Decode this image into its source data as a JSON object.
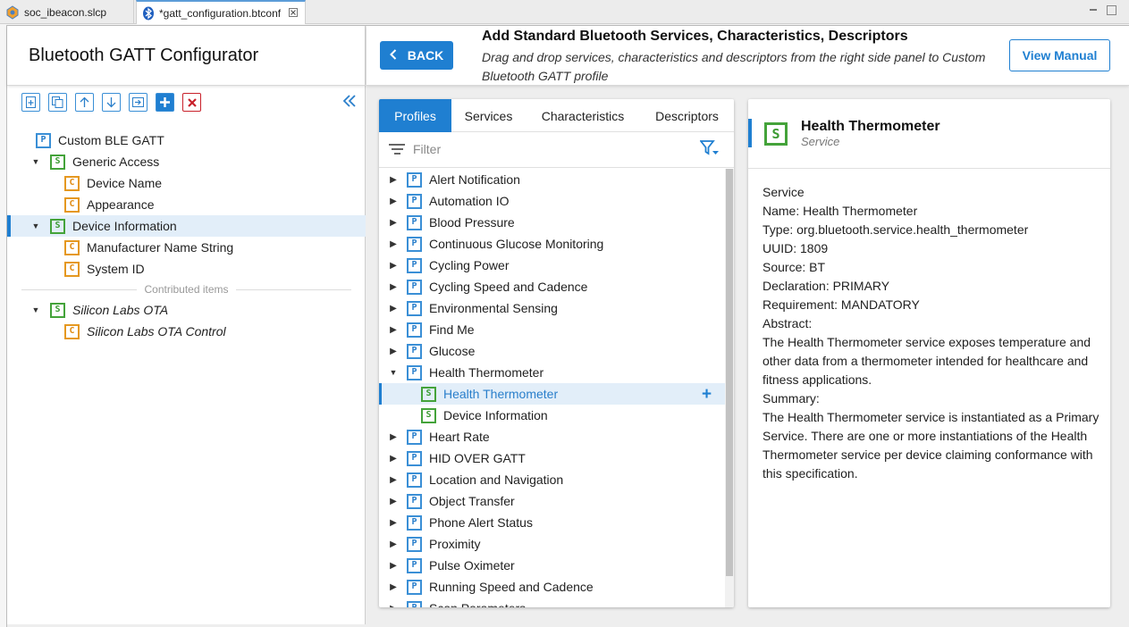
{
  "editor_tabs": [
    {
      "label": "soc_ibeacon.slcp",
      "icon": "project-icon"
    },
    {
      "label": "*gatt_configuration.btconf",
      "icon": "bluetooth-icon"
    }
  ],
  "left": {
    "title": "Bluetooth GATT Configurator",
    "toolbar": {
      "buttons": [
        "add-item-icon",
        "duplicate-icon",
        "move-up-icon",
        "move-down-icon",
        "import-icon",
        "add-icon",
        "delete-icon"
      ]
    },
    "collapse_icon": "double-chevron-left-icon",
    "tree": [
      {
        "label": "Custom BLE GATT",
        "type": "P"
      },
      {
        "label": "Generic Access",
        "type": "S"
      },
      {
        "label": "Device Name",
        "type": "C"
      },
      {
        "label": "Appearance",
        "type": "C"
      },
      {
        "label": "Device Information",
        "type": "S"
      },
      {
        "label": "Manufacturer Name String",
        "type": "C"
      },
      {
        "label": "System ID",
        "type": "C"
      }
    ],
    "contributed_label": "Contributed items",
    "contributed": [
      {
        "label": "Silicon Labs OTA",
        "type": "S"
      },
      {
        "label": "Silicon Labs OTA Control",
        "type": "C"
      }
    ]
  },
  "header": {
    "back_label": "BACK",
    "title": "Add Standard Bluetooth Services, Characteristics, Descriptors",
    "subtitle": "Drag and drop services, characteristics and descriptors from the right side panel to Custom Bluetooth GATT profile",
    "manual_label": "View Manual"
  },
  "middle": {
    "tabs": [
      "Profiles",
      "Services",
      "Characteristics",
      "Descriptors"
    ],
    "active_tab": "Profiles",
    "filter_placeholder": "Filter",
    "profiles": [
      "Alert Notification",
      "Automation IO",
      "Blood Pressure",
      "Continuous Glucose Monitoring",
      "Cycling Power",
      "Cycling Speed and Cadence",
      "Environmental Sensing",
      "Find Me",
      "Glucose",
      "Health Thermometer",
      "Health Thermometer",
      "Device Information",
      "Heart Rate",
      "HID OVER GATT",
      "Location and Navigation",
      "Object Transfer",
      "Phone Alert Status",
      "Proximity",
      "Pulse Oximeter",
      "Running Speed and Cadence",
      "Scan Parameters"
    ]
  },
  "info": {
    "name": "Health Thermometer",
    "kind": "Service",
    "lines": [
      "Service",
      "Name: Health Thermometer",
      "Type: org.bluetooth.service.health_thermometer",
      "UUID: 1809",
      "Source: BT",
      "Declaration: PRIMARY",
      "Requirement: MANDATORY",
      "Abstract:",
      "The Health Thermometer service exposes temperature and other data from a thermometer intended for healthcare and fitness applications.",
      "Summary:",
      "The Health Thermometer service is instantiated as a Primary Service. There are one or more instantiations of the Health Thermometer service per device claiming conformance with this specification."
    ]
  },
  "colors": {
    "accent": "#1f7fd1",
    "profile": "#3a8fd6",
    "service": "#44a33a",
    "characteristic": "#e59820",
    "delete": "#c8202a"
  }
}
